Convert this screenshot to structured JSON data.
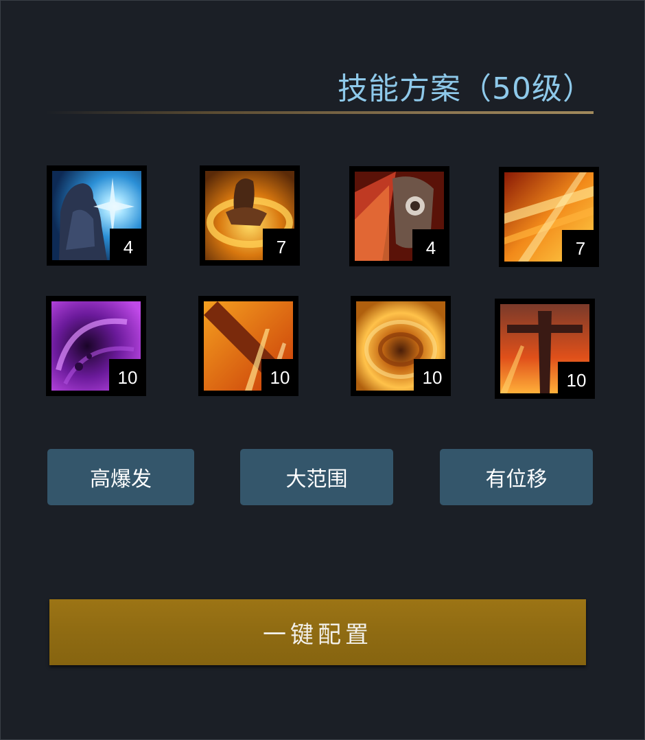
{
  "title": "技能方案（50级）",
  "skills": [
    {
      "icon": "cold-strike-icon",
      "level": "4"
    },
    {
      "icon": "fire-spin-icon",
      "level": "7"
    },
    {
      "icon": "gauntlet-flame-icon",
      "level": "4"
    },
    {
      "icon": "flame-burst-icon",
      "level": "7"
    },
    {
      "icon": "shadow-vortex-icon",
      "level": "10"
    },
    {
      "icon": "blazing-slash-icon",
      "level": "10"
    },
    {
      "icon": "fire-whirl-icon",
      "level": "10"
    },
    {
      "icon": "flaming-sword-icon",
      "level": "10"
    }
  ],
  "tags": [
    {
      "label": "高爆发"
    },
    {
      "label": "大范围"
    },
    {
      "label": "有位移"
    }
  ],
  "apply_button": "一键配置",
  "colors": {
    "background": "#1b1f26",
    "title": "#8ec9ea",
    "tag_button": "#34566b",
    "main_button": "#946f13"
  }
}
